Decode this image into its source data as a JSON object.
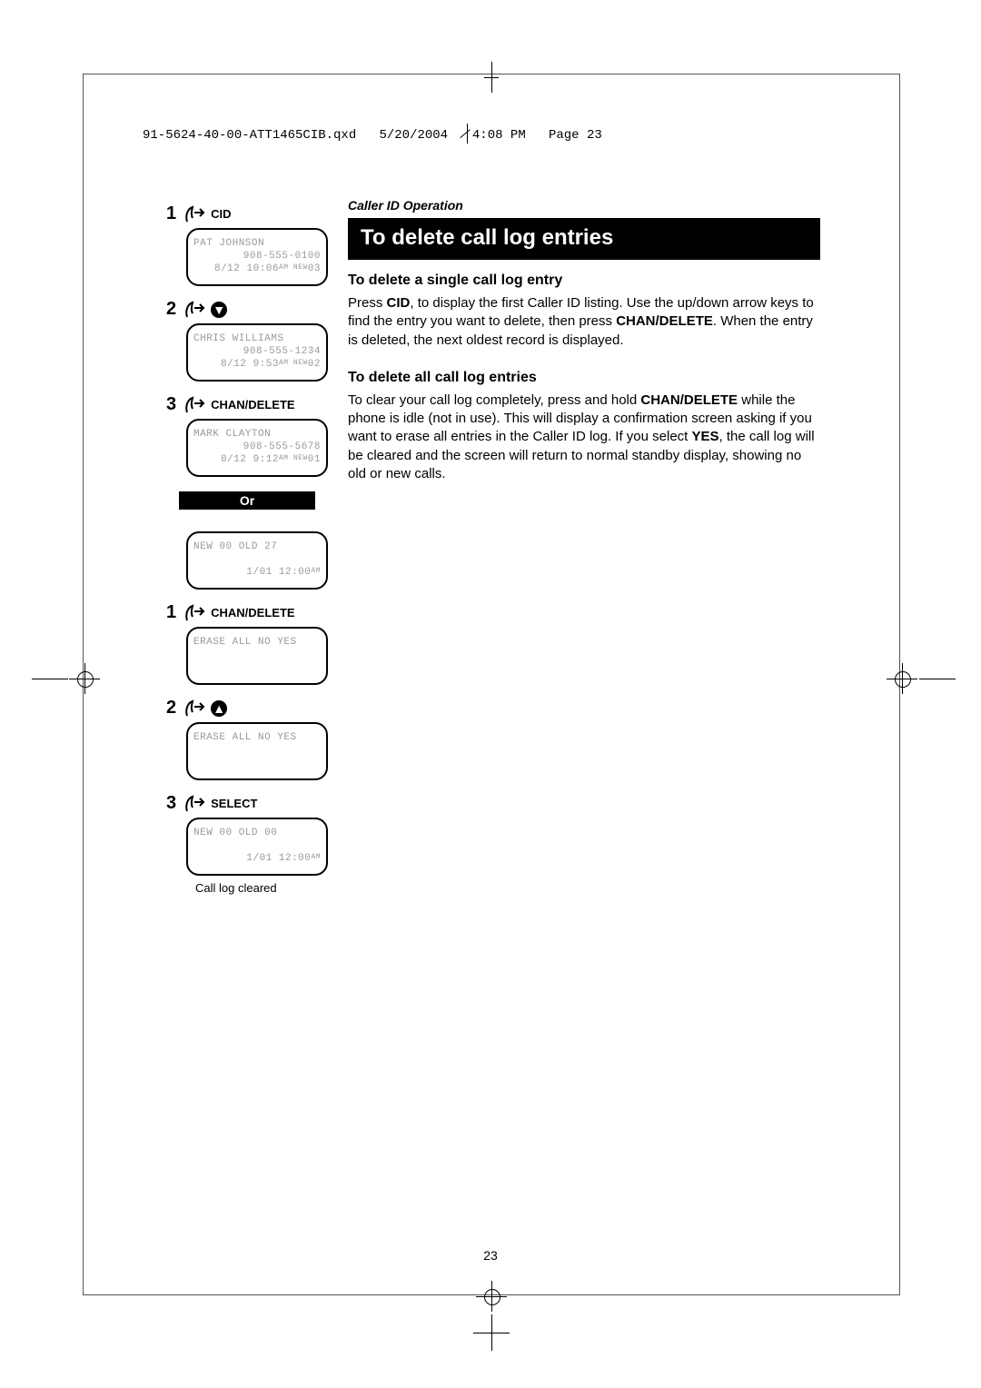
{
  "printline": {
    "file": "91-5624-40-00-ATT1465CIB.qxd",
    "date": "5/20/2004",
    "time": "4:08 PM",
    "page": "Page 23"
  },
  "section_label": "Caller ID Operation",
  "title": "To delete call log entries",
  "sub1": "To delete a single call log entry",
  "para1_a": "Press ",
  "para1_cid": "CID",
  "para1_b": ", to display the first Caller ID listing. Use the up/down arrow keys to find the entry you want to delete, then press ",
  "para1_chan": "CHAN/DELETE",
  "para1_c": ". When the entry is deleted, the next oldest record is displayed.",
  "sub2": "To delete all call log entries",
  "para2_a": "To clear your call log completely, press and hold ",
  "para2_chan": "CHAN/DELETE",
  "para2_b": " while the phone is idle (not in use). This will display a confirmation screen asking if you want to erase all entries in the Caller ID log. If you select ",
  "para2_yes": "YES",
  "para2_c": ", the call log will be cleared and the screen will return to normal standby display, showing no old or new calls.",
  "seqA": {
    "s1_label": "CID",
    "lcd1": {
      "l1": "PAT JOHNSON",
      "l2": "908-555-0100",
      "l3": "8/12 10:06",
      "badge": "AM NEW",
      "n": "03"
    },
    "s2_arrow": "▼",
    "lcd2": {
      "l1": "CHRIS WILLIAMS",
      "l2": "908-555-1234",
      "l3": "8/12 9:53",
      "badge": "AM NEW",
      "n": "02"
    },
    "s3_label": "CHAN/DELETE",
    "lcd3": {
      "l1": "MARK CLAYTON",
      "l2": "908-555-5678",
      "l3": "8/12 9:12",
      "badge": "AM NEW",
      "n": "01"
    }
  },
  "or_text": "Or",
  "seqB": {
    "lcd0": {
      "l1": "NEW 00  OLD 27",
      "l3": "1/01  12:00",
      "badge": "AM"
    },
    "s1_label": "CHAN/DELETE",
    "lcd1": {
      "l1": "ERASE ALL NO YES"
    },
    "s2_arrow": "▲",
    "lcd2": {
      "l1": "ERASE ALL NO YES"
    },
    "s3_label": "SELECT",
    "lcd3": {
      "l1": "NEW 00  OLD 00",
      "l3": "1/01  12:00",
      "badge": "AM"
    },
    "caption": "Call log cleared"
  },
  "page_number": "23"
}
